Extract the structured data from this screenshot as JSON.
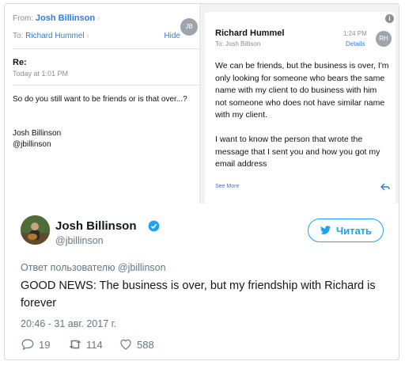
{
  "email_left": {
    "from_label": "From:",
    "from_name": "Josh Billinson",
    "to_label": "To:",
    "to_name": "Richard Hummel",
    "hide": "Hide",
    "avatar": "JB",
    "subject": "Re:",
    "date": "Today at 1:01 PM",
    "body": "So do you still want to be friends or is that over...?",
    "signature_name": "Josh Billinson",
    "signature_handle": "@jbillinson"
  },
  "email_right": {
    "sender": "Richard Hummel",
    "to_line": "To: Josh Billison",
    "time": "1:24 PM",
    "details": "Details",
    "avatar": "RH",
    "paragraph_1": "We can be friends, but the business is over, I'm only looking for someone who bears the same name with my client to do business with him not someone who does not have similar name with my client.",
    "paragraph_2": "I want to know the person that wrote the message that I sent you and how you got my email address",
    "see_more": "See More",
    "icons": [
      "info-icon",
      "reply-icon"
    ]
  },
  "tweet": {
    "name": "Josh Billinson",
    "handle": "@jbillinson",
    "follow_label": "Читать",
    "reply_to": "Ответ пользователю @jbillinson",
    "text": "GOOD NEWS: The business is over, but my friendship with Richard is forever",
    "date": "20:46 - 31 авг. 2017 г.",
    "replies": "19",
    "retweets": "114",
    "likes": "588",
    "accent_color": "#1da1f2",
    "icons": [
      "verified-icon",
      "twitter-bird-icon",
      "reply-icon",
      "retweet-icon",
      "heart-icon"
    ]
  }
}
